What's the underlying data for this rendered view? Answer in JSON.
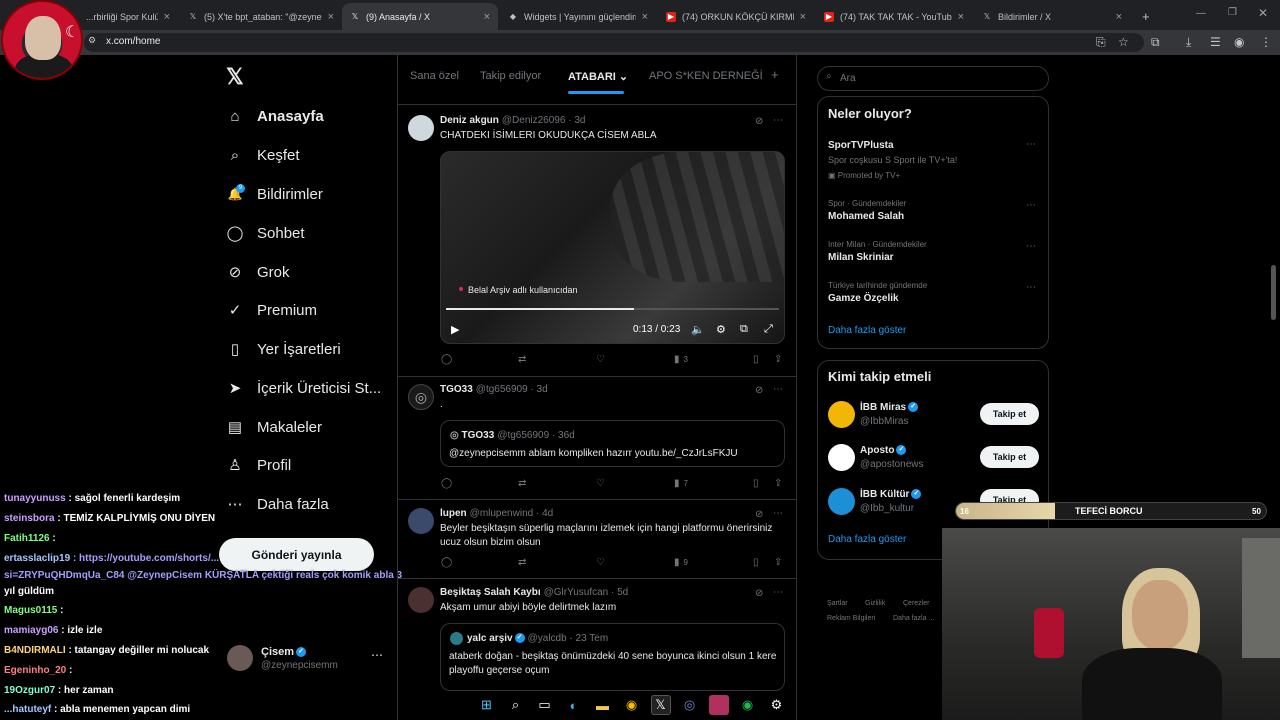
{
  "browser": {
    "tabs": [
      {
        "label": "...rbirliği Spor Kulübü",
        "icon": "favicon"
      },
      {
        "label": "(5) X'te bpt_ataban: \"@zeynep...",
        "icon": "x-icon"
      },
      {
        "label": "(9) Anasayfa / X",
        "icon": "x-icon",
        "active": true
      },
      {
        "label": "Widgets | Yayınını güçlendirme...",
        "icon": "widget-icon"
      },
      {
        "label": "(74) ORKUN KÖKÇÜ KIRMIZI K...",
        "icon": "youtube-icon"
      },
      {
        "label": "(74) TAK TAK TAK - YouTube",
        "icon": "youtube-icon"
      },
      {
        "label": "Bildirimler / X",
        "icon": "x-icon"
      }
    ],
    "new_tab": "+",
    "url": "x.com/home"
  },
  "sidebar": {
    "logo": "𝕏",
    "items": [
      {
        "label": "Anasayfa",
        "icon": "⌂"
      },
      {
        "label": "Keşfet",
        "icon": "⌕"
      },
      {
        "label": "Bildirimler",
        "icon": "🔔"
      },
      {
        "label": "Sohbet",
        "icon": "◯"
      },
      {
        "label": "Grok",
        "icon": "⊘"
      },
      {
        "label": "Premium",
        "icon": "✓"
      },
      {
        "label": "Yer İşaretleri",
        "icon": "▯"
      },
      {
        "label": "İçerik Üreticisi St...",
        "icon": "➤"
      },
      {
        "label": "Makaleler",
        "icon": "▤"
      },
      {
        "label": "Profil",
        "icon": "♙"
      },
      {
        "label": "Daha fazla",
        "icon": "⋯"
      }
    ],
    "post_button": "Gönderi yayınla",
    "profile": {
      "name": "Çisem",
      "handle": "@zeynepcisemm",
      "more": "⋯"
    }
  },
  "chat": [
    {
      "user": "tunayyunuss",
      "text": ": sağol fenerli kardeşim"
    },
    {
      "user": "steinsbora",
      "text": ": TEMİZ KALPLİYMİŞ ONU DİYEN"
    },
    {
      "user": "Fatih1126",
      "text": ":"
    },
    {
      "user": "ertasslaclip19",
      "text": ": https://youtube.com/shorts/..."
    },
    {
      "user": "",
      "text": "si=ZRYPuQHDmqUa_C84 @ZeynepCisem KÜRŞATLA çektiği reals çok komik abla 3"
    },
    {
      "user": "",
      "text": "yıl güldüm"
    },
    {
      "user": "Magus0115",
      "text": ":"
    },
    {
      "user": "mamiayg06",
      "text": ": izle izle"
    },
    {
      "user": "B4NDIRMALI",
      "text": ": tatangay değiller mi nolucak"
    },
    {
      "user": "Egeninho_20",
      "text": ":"
    },
    {
      "user": "19Ozgur07",
      "text": ": her zaman"
    },
    {
      "user": "...hatuteyf",
      "text": ": abla menemen yapcan dimi"
    }
  ],
  "timeline": {
    "tabs": [
      "Sana özel",
      "Takip edilyor",
      "ATABARI ⌄",
      "APO S*KEN DERNEĞİ",
      "+"
    ],
    "tweets": [
      {
        "name": "Deniz akgun",
        "handle": "@Deniz26096 · 3d",
        "text": "CHATDEKI İSİMLERI OKUDUKÇA CİSEM ABLA",
        "video": {
          "caption": "Belal Arşiv adlı kullanıcıdan",
          "time": "0:13 / 0:23",
          "progress": 0.565
        },
        "actions": {
          "reply": "",
          "retweet": "",
          "like": "",
          "views": "3"
        }
      },
      {
        "name": "TGO33",
        "handle": "@tg656909 · 3d",
        "text": ".",
        "quote": {
          "name": "TGO33",
          "handle": "@tg656909 · 36d",
          "text": "@zeynepcisemm ablam kompliken hazırr youtu.be/_CzJrLsFKJU"
        },
        "actions": {
          "reply": "",
          "retweet": "",
          "like": "",
          "views": "7"
        }
      },
      {
        "name": "lupen",
        "handle": "@mlupenwind · 4d",
        "text": "Beyler beşiktaşın süperlig maçlarını izlemek için hangi platformu önerirsiniz ucuz olsun bizim olsun",
        "actions": {
          "reply": "",
          "retweet": "",
          "like": "",
          "views": "9"
        }
      },
      {
        "name": "Beşiktaş Salah Kaybı",
        "handle": "@GlrYusufcan · 5d",
        "text": "Akşam umur abiyi böyle delirtmek lazım",
        "quote": {
          "name": "yalc arşiv",
          "handle": "@yalcdb · 23 Tem",
          "text": "ataberk doğan - beşiktaş önümüzdeki 40 sene boyunca ikinci olsun 1 kere playoffu geçerse oçum"
        }
      }
    ]
  },
  "right": {
    "search_placeholder": "Ara",
    "trends_title": "Neler oluyor?",
    "trends": [
      {
        "category": "",
        "name": "SporTVPlusta",
        "desc": "Spor coşkusu S Sport ile TV+'ta!",
        "promo": "Promoted by TV+"
      },
      {
        "category": "Spor · Gündemdekiler",
        "name": "Mohamed Salah"
      },
      {
        "category": "Inter Milan · Gündemdekiler",
        "name": "Milan Skriniar"
      },
      {
        "category": "Türkiye tarihinde gündemde",
        "name": "Gamze Özçelik"
      }
    ],
    "trends_more": "Daha fazla göster",
    "follow_title": "Kimi takip etmeli",
    "follow": [
      {
        "name": "İBB Miras",
        "handle": "@IbbMiras",
        "button": "Takip et",
        "color": "#f2b705"
      },
      {
        "name": "Aposto",
        "handle": "@apostonews",
        "button": "Takip et",
        "color": "#ffffff"
      },
      {
        "name": "İBB Kültür",
        "handle": "@Ibb_kultur",
        "button": "Takip et",
        "color": "#1d8fd6"
      }
    ],
    "follow_more": "Daha fazla göster",
    "footer": [
      "Şartlar",
      "Gizlilik",
      "Çerezler",
      "Reklam Bilgileri",
      "Daha fazla ..."
    ]
  },
  "overlay": {
    "goal": {
      "current": "16",
      "label": "TEFECİ BORCU",
      "max": "50",
      "progress": 0.32
    }
  },
  "colors": {
    "accent": "#1d9bf0",
    "bg": "#000000",
    "border": "#2f3336",
    "muted": "#71767b"
  }
}
